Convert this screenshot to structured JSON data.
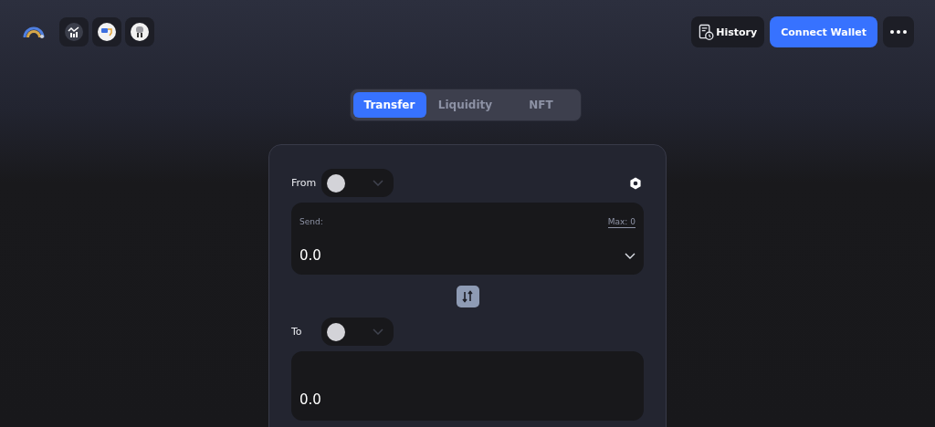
{
  "header": {
    "apps": [
      {
        "kind": "chart"
      },
      {
        "kind": "sticker"
      },
      {
        "kind": "robot"
      }
    ],
    "history_button": "History",
    "connect_button": "Connect Wallet"
  },
  "tabs": [
    {
      "label": "Transfer",
      "selected": true
    },
    {
      "label": "Liquidity",
      "selected": false
    },
    {
      "label": "NFT",
      "selected": false
    }
  ],
  "transfer": {
    "from_label": "From",
    "send_label": "Send:",
    "max": "Max: 0",
    "send_value": "0.0",
    "to_label": "To",
    "receive_value": "0.0"
  }
}
